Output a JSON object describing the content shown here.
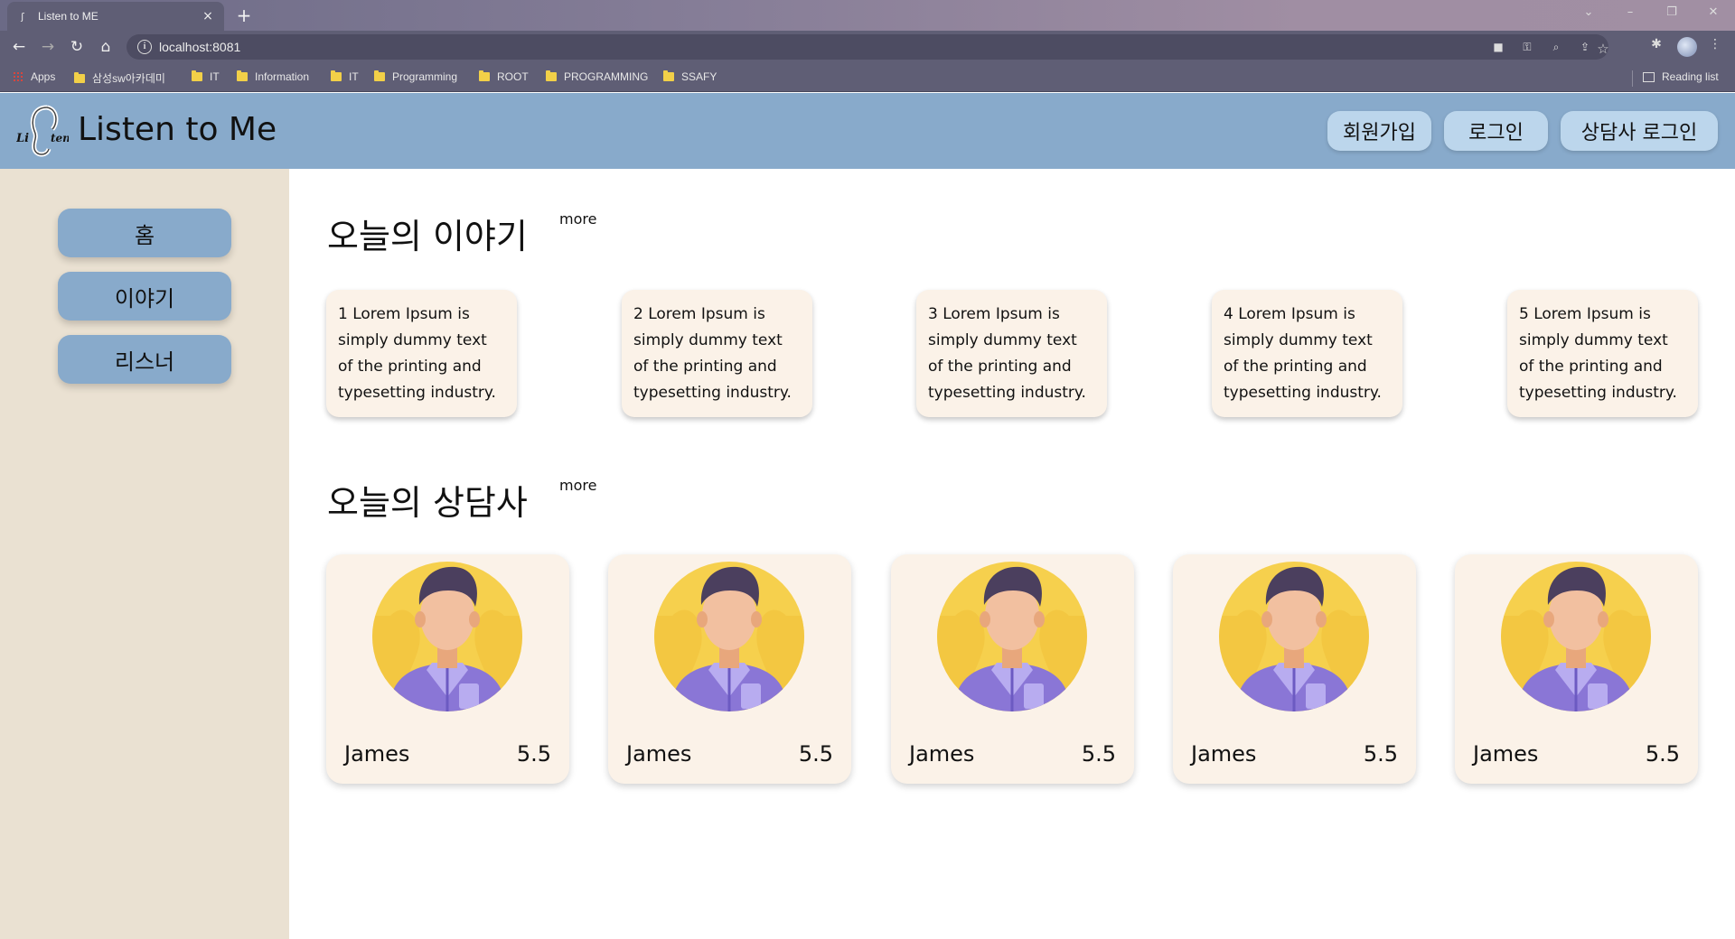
{
  "browser": {
    "tab_title": "Listen to ME",
    "tab_close": "×",
    "new_tab": "+",
    "url": "localhost:8081",
    "bookmarks": [
      "Apps",
      "삼성sw아카데미",
      "IT",
      "Information",
      "IT",
      "Programming",
      "ROOT",
      "PROGRAMMING",
      "SSAFY"
    ],
    "reading_list": "Reading list"
  },
  "header": {
    "site_title": "Listen to Me",
    "buttons": {
      "signup": "회원가입",
      "login": "로그인",
      "counselor_login": "상담사 로그인"
    }
  },
  "sidebar": {
    "items": [
      {
        "label": "홈"
      },
      {
        "label": "이야기"
      },
      {
        "label": "리스너"
      }
    ]
  },
  "stories_section": {
    "title": "오늘의 이야기",
    "more": "more",
    "items": [
      {
        "text": "1 Lorem Ipsum is simply dummy text of the printing and typesetting industry."
      },
      {
        "text": "2 Lorem Ipsum is simply dummy text of the printing and typesetting industry."
      },
      {
        "text": "3 Lorem Ipsum is simply dummy text of the printing and typesetting industry."
      },
      {
        "text": "4 Lorem Ipsum is simply dummy text of the printing and typesetting industry."
      },
      {
        "text": "5 Lorem Ipsum is simply dummy text of the printing and typesetting industry."
      }
    ]
  },
  "counselors_section": {
    "title": "오늘의 상담사",
    "more": "more",
    "items": [
      {
        "name": "James",
        "score": "5.5"
      },
      {
        "name": "James",
        "score": "5.5"
      },
      {
        "name": "James",
        "score": "5.5"
      },
      {
        "name": "James",
        "score": "5.5"
      },
      {
        "name": "James",
        "score": "5.5"
      }
    ]
  },
  "colors": {
    "header_bg": "#88aacb",
    "sidebar_bg": "#eae1d2",
    "card_bg": "#fbf2e8",
    "header_button_bg": "#bcd6ec"
  }
}
